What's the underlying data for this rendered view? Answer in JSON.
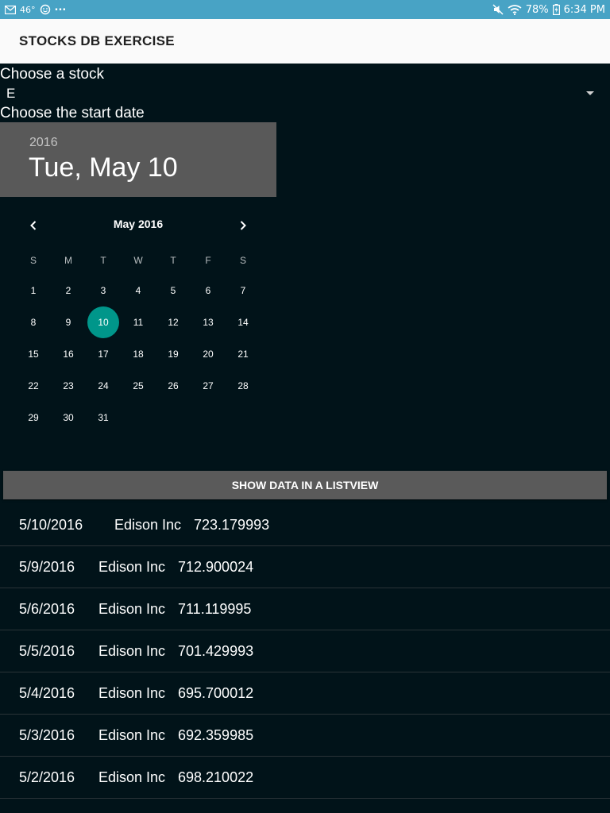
{
  "status_bar": {
    "temperature": "46°",
    "ellipsis": "...",
    "battery": "78%",
    "time": "6:34 PM",
    "icons": [
      "mail-icon",
      "weather-icon",
      "mute-icon",
      "wifi-icon",
      "battery-icon"
    ]
  },
  "app": {
    "title": "STOCKS DB EXERCISE"
  },
  "stock_picker": {
    "label": "Choose a stock",
    "selected": "E"
  },
  "date_picker": {
    "label": "Choose the start date",
    "header_year": "2016",
    "header_date": "Tue, May 10",
    "month_title": "May 2016",
    "weekdays": [
      "S",
      "M",
      "T",
      "W",
      "T",
      "F",
      "S"
    ],
    "days": [
      "1",
      "2",
      "3",
      "4",
      "5",
      "6",
      "7",
      "8",
      "9",
      "10",
      "11",
      "12",
      "13",
      "14",
      "15",
      "16",
      "17",
      "18",
      "19",
      "20",
      "21",
      "22",
      "23",
      "24",
      "25",
      "26",
      "27",
      "28",
      "29",
      "30",
      "31"
    ],
    "first_weekday_index": 0,
    "selected_day": 10
  },
  "show_button": {
    "label": "SHOW DATA IN A LISTVIEW"
  },
  "list": [
    {
      "date": "5/10/2016",
      "name": "Edison Inc",
      "price": "723.179993"
    },
    {
      "date": "5/9/2016",
      "name": "Edison Inc",
      "price": "712.900024"
    },
    {
      "date": "5/6/2016",
      "name": "Edison Inc",
      "price": "711.119995"
    },
    {
      "date": "5/5/2016",
      "name": "Edison Inc",
      "price": "701.429993"
    },
    {
      "date": "5/4/2016",
      "name": "Edison Inc",
      "price": "695.700012"
    },
    {
      "date": "5/3/2016",
      "name": "Edison Inc",
      "price": "692.359985"
    },
    {
      "date": "5/2/2016",
      "name": "Edison Inc",
      "price": "698.210022"
    }
  ],
  "colors": {
    "status_bar": "#48a3c5",
    "background": "#011319",
    "accent": "#00968a",
    "header": "#595959"
  }
}
